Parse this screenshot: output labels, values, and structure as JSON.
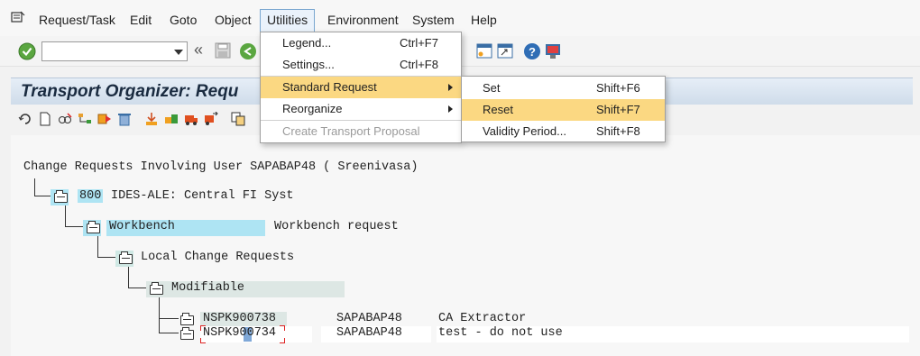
{
  "menubar": {
    "items": [
      "Request/Task",
      "Edit",
      "Goto",
      "Object",
      "Utilities",
      "Environment",
      "System",
      "Help"
    ]
  },
  "toolbar": {
    "command_field_value": ""
  },
  "title": "Transport Organizer: Requ",
  "utilities_menu": {
    "items": [
      {
        "label": "Legend...",
        "shortcut": "Ctrl+F7"
      },
      {
        "label": "Settings...",
        "shortcut": "Ctrl+F8"
      },
      {
        "label": "Standard Request",
        "shortcut": ""
      },
      {
        "label": "Reorganize",
        "shortcut": ""
      },
      {
        "label": "Create Transport Proposal",
        "shortcut": ""
      }
    ]
  },
  "standard_request_submenu": {
    "items": [
      {
        "label": "Set",
        "shortcut": "Shift+F6"
      },
      {
        "label": "Reset",
        "shortcut": "Shift+F7"
      },
      {
        "label": "Validity Period...",
        "shortcut": "Shift+F8"
      }
    ]
  },
  "tree": {
    "root": "Change Requests Involving User SAPABAP48 ( Sreenivasa)",
    "client_num": "800",
    "client_desc": "IDES-ALE: Central FI Syst",
    "workbench_label": "Workbench",
    "workbench_desc": "Workbench request",
    "local_label": "Local Change Requests",
    "modifiable_label": "Modifiable",
    "requests": [
      {
        "id": "NSPK900738",
        "owner": "SAPABAP48",
        "desc": "CA Extractor"
      },
      {
        "id": "NSPK900734",
        "owner": "SAPABAP48",
        "desc": "test - do not use"
      }
    ]
  }
}
